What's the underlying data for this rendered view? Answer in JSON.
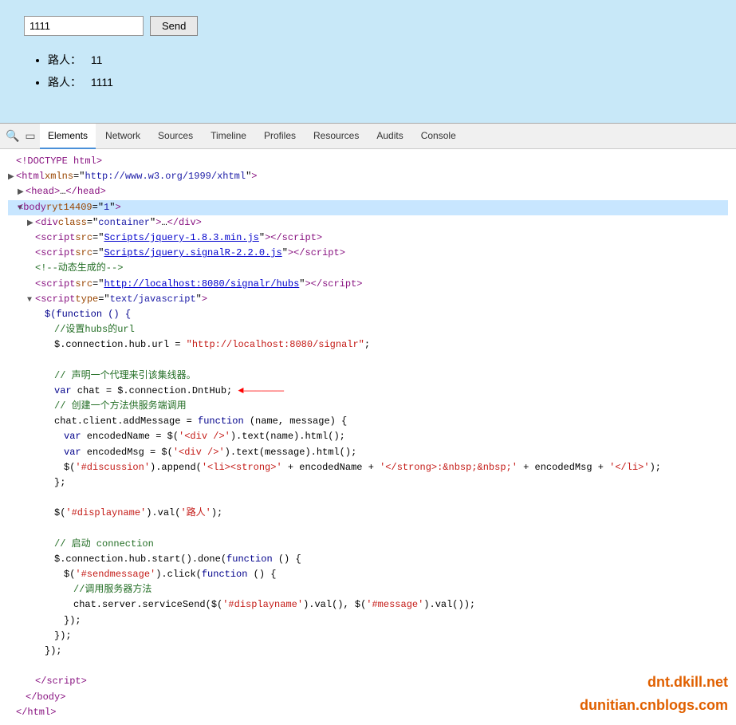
{
  "preview": {
    "input_value": "1111",
    "send_label": "Send",
    "chat_items": [
      {
        "name": "路人：",
        "message": "11"
      },
      {
        "name": "路人：",
        "message": "1111"
      }
    ]
  },
  "devtools": {
    "tabs": [
      {
        "id": "elements",
        "label": "Elements",
        "active": true
      },
      {
        "id": "network",
        "label": "Network",
        "active": false
      },
      {
        "id": "sources",
        "label": "Sources",
        "active": false
      },
      {
        "id": "timeline",
        "label": "Timeline",
        "active": false
      },
      {
        "id": "profiles",
        "label": "Profiles",
        "active": false
      },
      {
        "id": "resources",
        "label": "Resources",
        "active": false
      },
      {
        "id": "audits",
        "label": "Audits",
        "active": false
      },
      {
        "id": "console",
        "label": "Console",
        "active": false
      }
    ]
  },
  "code": {
    "doctype": "<!DOCTYPE html>",
    "watermark1": "dnt.dkill.net",
    "watermark2": "dunitian.cnblogs.com"
  }
}
